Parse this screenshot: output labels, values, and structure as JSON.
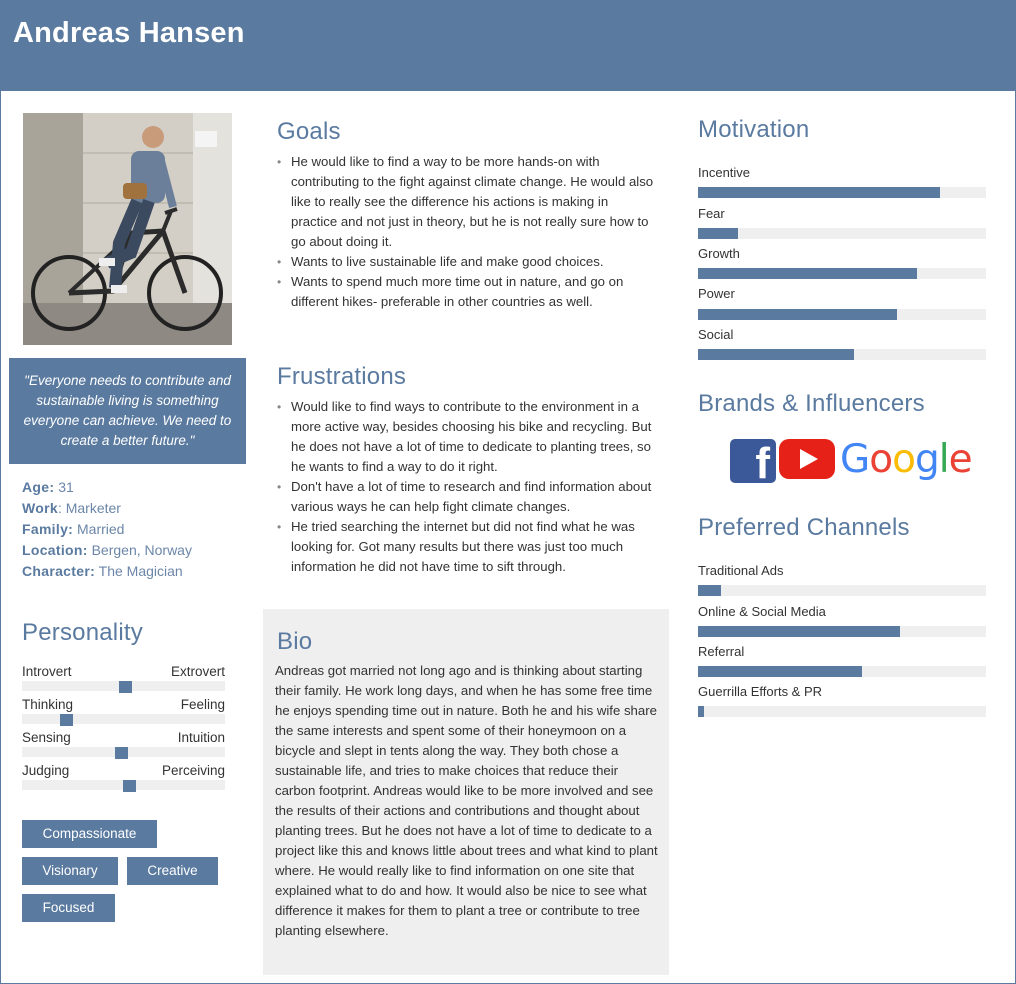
{
  "persona": {
    "name": "Andreas Hansen",
    "quote": "\"Everyone needs to contribute and sustainable living is something everyone can achieve. We need to create a better future.\"",
    "facts": [
      {
        "label": "Age:",
        "value": " 31"
      },
      {
        "label": "Work",
        "value": ": Marketer"
      },
      {
        "label": "Family:",
        "value": " Married"
      },
      {
        "label": "Location:",
        "value": " Bergen, Norway"
      },
      {
        "label": "Character:",
        "value": " The Magician"
      }
    ]
  },
  "personality": {
    "title": "Personality",
    "traits": [
      {
        "left": "Introvert",
        "right": "Extrovert",
        "position": 0.51
      },
      {
        "left": "Thinking",
        "right": "Feeling",
        "position": 0.22
      },
      {
        "left": "Sensing",
        "right": "Intuition",
        "position": 0.49
      },
      {
        "left": "Judging",
        "right": "Perceiving",
        "position": 0.53
      }
    ],
    "tags": [
      "Compassionate",
      "Visionary",
      "Creative",
      "Focused"
    ]
  },
  "goals": {
    "title": "Goals",
    "items": [
      "He would like to find a way to be more hands-on with contributing to the fight against climate change. He would also like to really see the difference his actions is making in practice and not just in theory, but he is not really sure how to go about doing it.",
      "Wants to live sustainable life and make good choices.",
      "Wants to spend much more time out in nature, and go on different hikes- preferable in other countries as well."
    ]
  },
  "frustrations": {
    "title": "Frustrations",
    "items": [
      "Would like to find ways to contribute to the environment in a more active way, besides choosing his bike and recycling. But he does not have a lot of time to dedicate to planting trees, so he wants to find a way to do it right.",
      "Don't have a lot of time to research and find information about various ways he can help fight climate changes.",
      "He tried searching the internet but did not find what he was looking for. Got many results but there was just too much information he did not have time to sift through."
    ]
  },
  "bio": {
    "title": "Bio",
    "text": "Andreas got married not long ago and is thinking about starting their family. He work long days, and when he has some free time he enjoys spending time out in nature. Both he and his wife share the same interests and spent some of their honeymoon on a bicycle and slept in tents along the way. They both chose a sustainable life, and tries to make choices that reduce their carbon footprint. Andreas would like to be more involved and see the results of their actions and contributions and thought about planting trees. But he does not have a lot of time to dedicate to a project like this and knows little about trees and what kind to plant where. He would really like to find information on one site that explained what to do and how. It would also be nice to see what difference it makes for them to plant a tree or contribute to tree planting elsewhere."
  },
  "motivation": {
    "title": "Motivation",
    "items": [
      {
        "label": "Incentive",
        "level": 0.84
      },
      {
        "label": "Fear",
        "level": 0.14
      },
      {
        "label": "Growth",
        "level": 0.76
      },
      {
        "label": "Power",
        "level": 0.69
      },
      {
        "label": "Social",
        "level": 0.54
      }
    ]
  },
  "brands": {
    "title": "Brands & Influencers",
    "logos": [
      "facebook-logo",
      "youtube-logo",
      "google-logo"
    ],
    "google_wordmark": "Google"
  },
  "channels": {
    "title": "Preferred Channels",
    "items": [
      {
        "label": "Traditional Ads",
        "level": 0.08
      },
      {
        "label": "Online & Social Media",
        "level": 0.7
      },
      {
        "label": "Referral",
        "level": 0.57
      },
      {
        "label": "Guerrilla Efforts & PR",
        "level": 0.02
      }
    ]
  },
  "colors": {
    "accent": "#5a7aa0",
    "track": "#efefef"
  }
}
